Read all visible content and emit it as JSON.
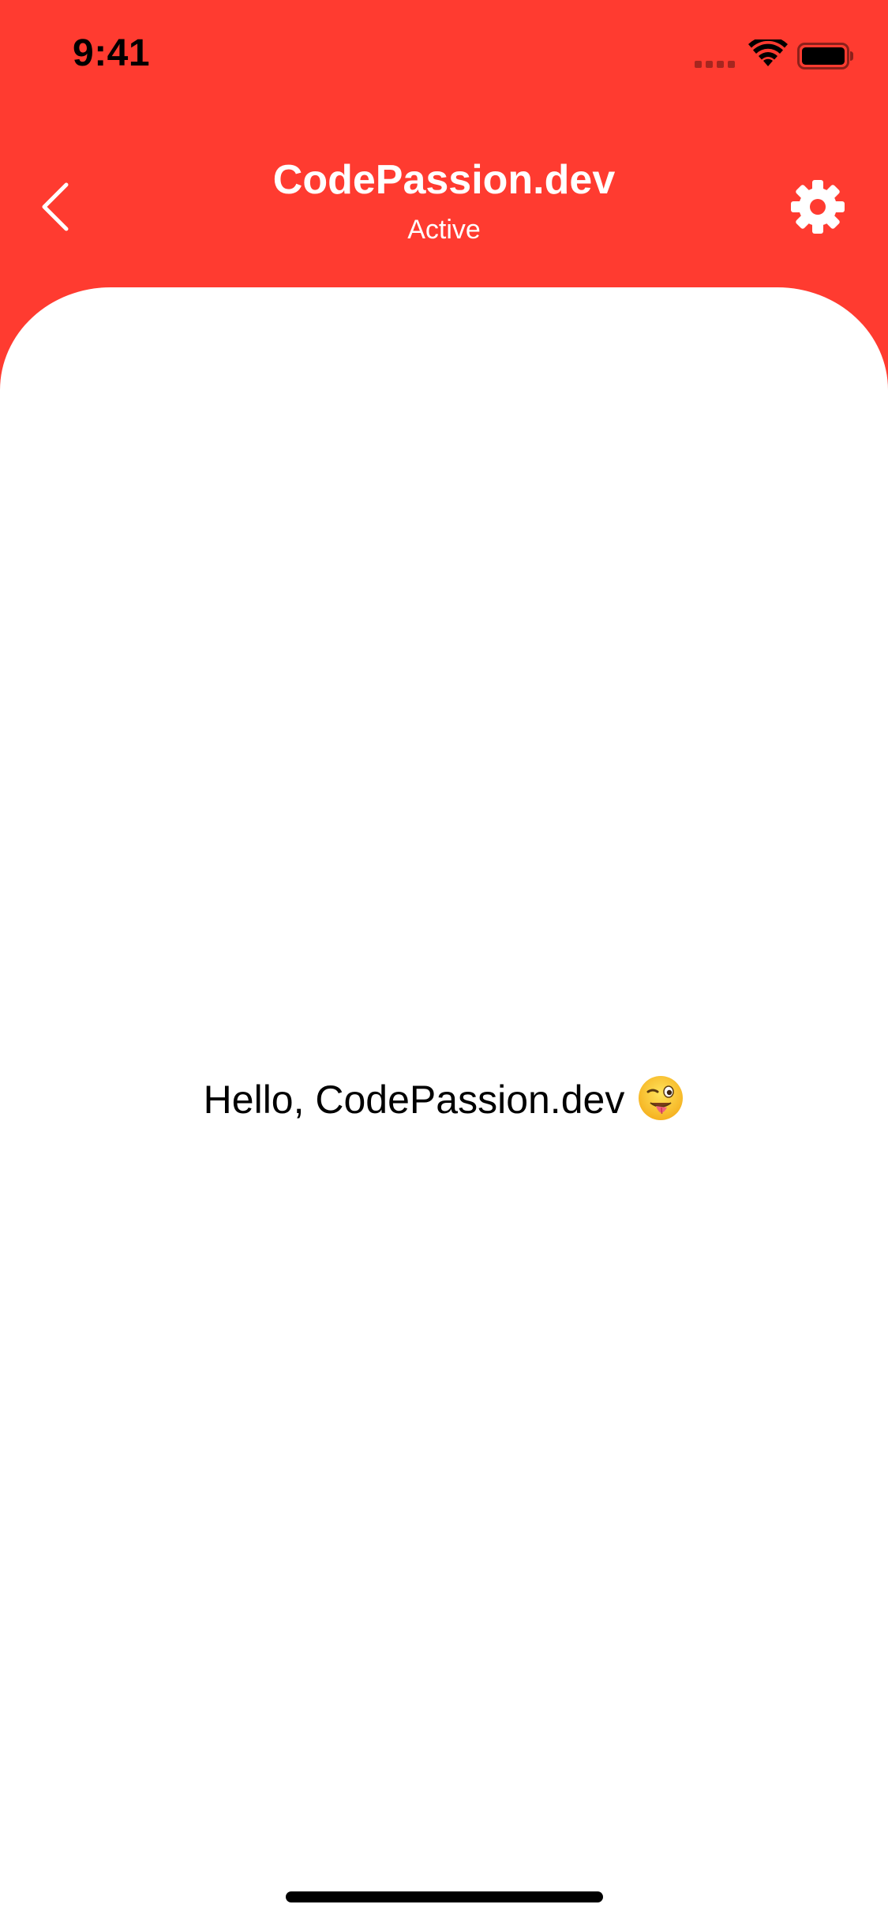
{
  "status_bar": {
    "time": "9:41",
    "icons": [
      "signal-icon",
      "wifi-icon",
      "battery-icon"
    ]
  },
  "header": {
    "title": "CodePassion.dev",
    "subtitle": "Active",
    "back_icon": "chevron-left-icon",
    "settings_icon": "gear-icon"
  },
  "content": {
    "greeting": "Hello, CodePassion.dev",
    "emoji_icon": "winking-face-with-tongue-icon"
  },
  "colors": {
    "accent": "#ff3b30",
    "card": "#ffffff",
    "text": "#000000"
  }
}
